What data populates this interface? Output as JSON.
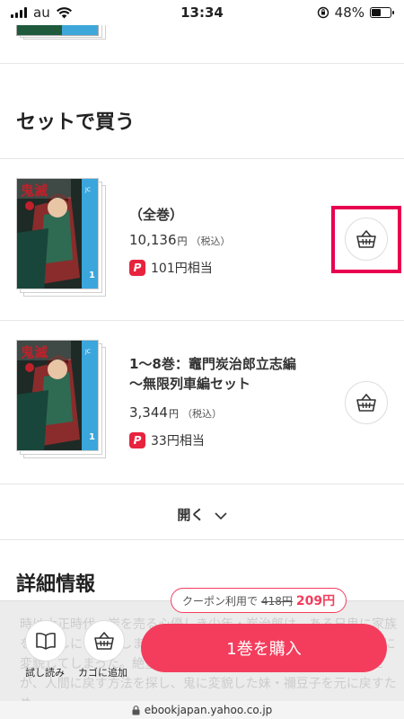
{
  "status_bar": {
    "carrier": "au",
    "time": "13:34",
    "battery": "48%",
    "battery_level": 0.48
  },
  "set_section": {
    "title": "セットで買う",
    "items": [
      {
        "title_line1": "（全巻）",
        "title_line2": "",
        "price": "10,136",
        "yen": "円",
        "tax": "（税込）",
        "points": "101円相当",
        "cover_number": "1"
      },
      {
        "title_line1": "1〜8巻：竈門炭治郎立志編",
        "title_line2": "〜無限列車編セット",
        "price": "3,344",
        "yen": "円",
        "tax": "（税込）",
        "points": "33円相当",
        "cover_number": "1"
      }
    ],
    "open_more": "開く"
  },
  "detail_section": {
    "title": "詳細情報",
    "behind_text": "時は大正時代。炭を売る心優しき少年・炭治郎は、ある日鬼に家族を皆殺しにされてしまう。さらに唯一生き残った妹・禰豆子は鬼に変貌してしまった。絶望的な現実に打ちのめされる炭治郎だったが、人間に戻す方法を探し、鬼に変貌した妹・禰豆子を元に戻すため..."
  },
  "bottom_bar": {
    "trial_read": "試し読み",
    "add_to_cart": "カゴに追加",
    "buy_label": "1巻を購入",
    "coupon_prefix": "クーポン利用で",
    "coupon_old_price": "418円",
    "coupon_new_price": "209円"
  },
  "url": "ebookjapan.yahoo.co.jp",
  "colors": {
    "accent": "#f43d5d",
    "highlight": "#e8004f",
    "paypay": "#e8233e"
  }
}
